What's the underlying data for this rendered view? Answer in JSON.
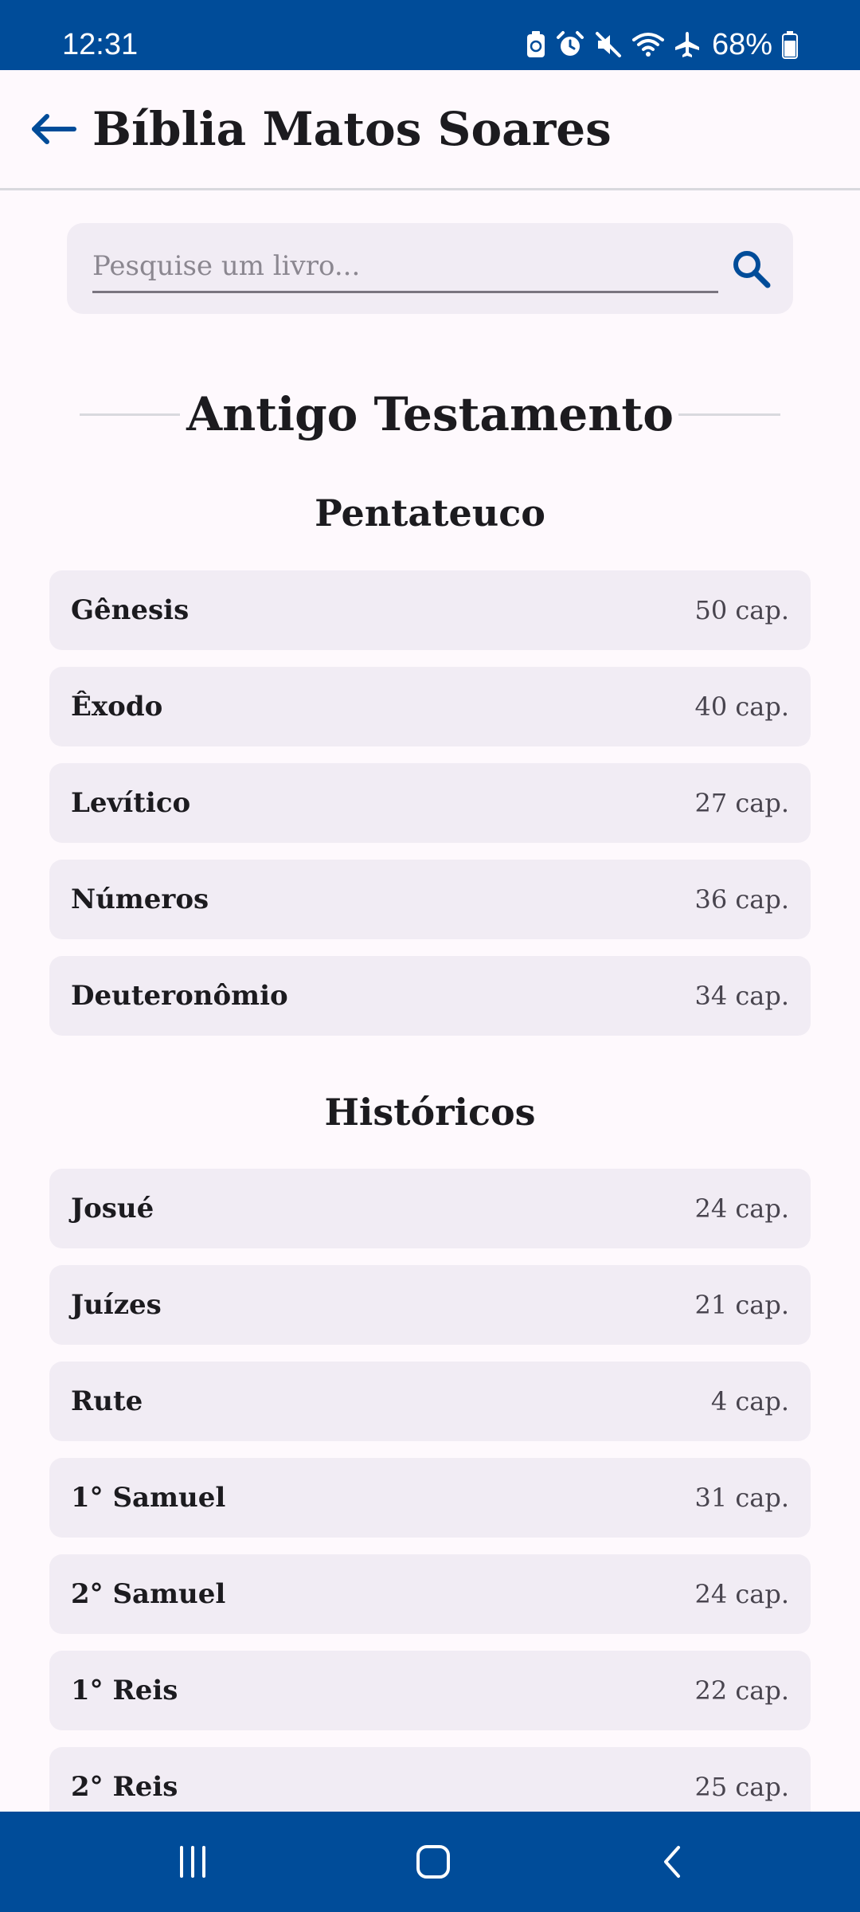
{
  "status_bar": {
    "time": "12:31",
    "battery": "68%",
    "icons": [
      "battery-saver-icon",
      "alarm-icon",
      "mute-icon",
      "wifi-icon",
      "airplane-icon",
      "battery-icon"
    ]
  },
  "app_bar": {
    "title": "Bíblia Matos Soares",
    "back_icon": "arrow-back-icon"
  },
  "search": {
    "placeholder": "Pesquise um livro...",
    "value": "",
    "icon": "search-icon"
  },
  "testament": {
    "title": "Antigo Testamento"
  },
  "groups": [
    {
      "title": "Pentateuco",
      "books": [
        {
          "name": "Gênesis",
          "chapters": "50 cap."
        },
        {
          "name": "Êxodo",
          "chapters": "40 cap."
        },
        {
          "name": "Levítico",
          "chapters": "27 cap."
        },
        {
          "name": "Números",
          "chapters": "36 cap."
        },
        {
          "name": "Deuteronômio",
          "chapters": "34 cap."
        }
      ]
    },
    {
      "title": "Históricos",
      "books": [
        {
          "name": "Josué",
          "chapters": "24 cap."
        },
        {
          "name": "Juízes",
          "chapters": "21 cap."
        },
        {
          "name": "Rute",
          "chapters": "4 cap."
        },
        {
          "name": "1° Samuel",
          "chapters": "31 cap."
        },
        {
          "name": "2° Samuel",
          "chapters": "24 cap."
        },
        {
          "name": "1° Reis",
          "chapters": "22 cap."
        },
        {
          "name": "2° Reis",
          "chapters": "25 cap."
        }
      ]
    }
  ],
  "nav_bar": {
    "icons": [
      "recent-apps-icon",
      "home-icon",
      "back-icon"
    ]
  },
  "colors": {
    "primary": "#004C99",
    "background": "#FEF9FD",
    "card": "#F1ECF4"
  }
}
